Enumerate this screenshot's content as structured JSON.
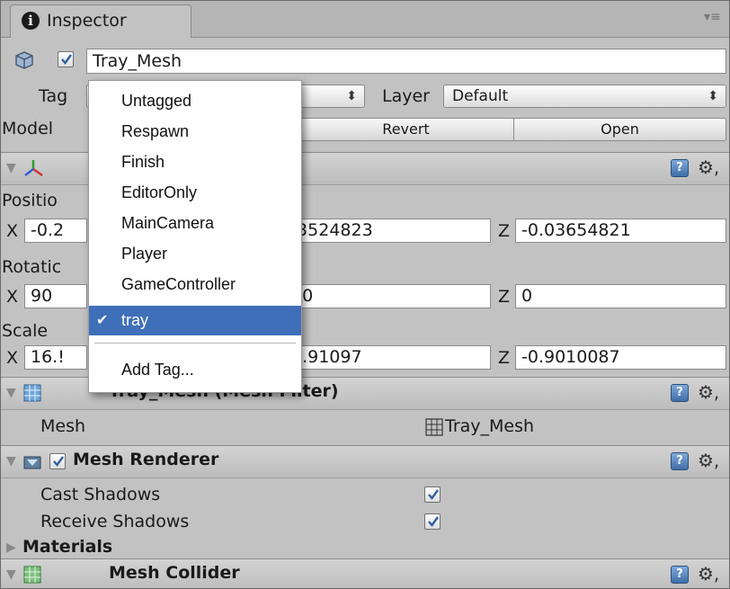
{
  "tab": {
    "title": "Inspector",
    "info_glyph": "i",
    "menu_glyph": "▾≡"
  },
  "object": {
    "name": "Tray_Mesh",
    "active": true
  },
  "tag_row": {
    "tag_label": "Tag",
    "tag_value": "",
    "layer_label": "Layer",
    "layer_value": "Default"
  },
  "model_row": {
    "label": "Model",
    "revert_label": "Revert",
    "open_label": "Open"
  },
  "transform": {
    "position_label": "Positio",
    "position": {
      "x_label": "X",
      "x": "-0.2",
      "y": ".3524823",
      "z_label": "Z",
      "z": "-0.03654821"
    },
    "rotation_label": "Rotatic",
    "rotation": {
      "x_label": "X",
      "x": "90",
      "y": "80",
      "z_label": "Z",
      "z": "0"
    },
    "scale_label": "Scale",
    "scale": {
      "x_label": "X",
      "x": "16.!",
      "y": "0.91097",
      "z_label": "Z",
      "z": "-0.9010087"
    }
  },
  "mesh_filter": {
    "title": "Tray_Mesh (Mesh Filter)",
    "mesh_label": "Mesh",
    "mesh_value": "Tray_Mesh"
  },
  "mesh_renderer": {
    "title": "Mesh Renderer",
    "cast_shadows_label": "Cast Shadows",
    "cast_shadows": true,
    "receive_shadows_label": "Receive Shadows",
    "receive_shadows": true,
    "materials_label": "Materials"
  },
  "mesh_collider": {
    "title": "Mesh Collider"
  },
  "help_glyph": "?",
  "gear_glyph": "⚙,",
  "tag_menu": {
    "items": [
      "Untagged",
      "Respawn",
      "Finish",
      "EditorOnly",
      "MainCamera",
      "Player",
      "GameController",
      "tray"
    ],
    "selected": "tray",
    "check_glyph": "✔",
    "add_tag_label": "Add Tag..."
  },
  "colors": {
    "selection": "#3f6fb8",
    "panel": "#c2c2c2",
    "help_icon": "#4f7fbf"
  }
}
